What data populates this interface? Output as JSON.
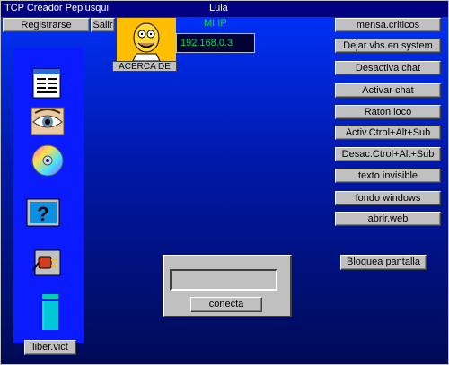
{
  "window": {
    "title": "TCP Creador Pepiusqui",
    "center_label": "Lula"
  },
  "menu": {
    "register_label": "Registrarse",
    "exit_label": "Salir"
  },
  "info": {
    "acerca_label": "ACERCA DE",
    "my_ip_label": "MI IP",
    "ip_value": "192.168.0.3"
  },
  "right_buttons": [
    "mensa.criticos",
    "Dejar vbs en system",
    "Desactiva chat",
    "Activar chat",
    "Raton loco",
    "Activ.Ctrol+Alt+Sub",
    "Desac.Ctrol+Alt+Sub",
    "texto invisible",
    "fondo windows",
    "abrir.web"
  ],
  "bloquea_label": "Bloquea pantalla",
  "liber_label": "liber.vict",
  "connect": {
    "input_value": "",
    "button_label": "conecta"
  },
  "icons": [
    "document-icon",
    "eye-icon",
    "cd-icon",
    "help-icon",
    "plug-icon",
    "file-icon"
  ],
  "colors": {
    "titlebar": "#000080",
    "ip_text": "#00e04a",
    "avatar_bg": "#ffbf00"
  }
}
